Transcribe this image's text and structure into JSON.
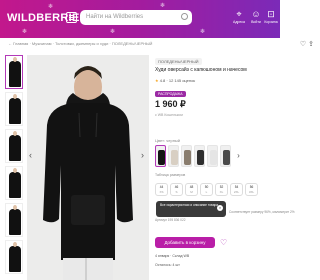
{
  "header": {
    "logo": "WILDBERRIES",
    "search_placeholder": "Найти на Wildberries",
    "icons": [
      {
        "name": "location-icon",
        "label": "Адреса"
      },
      {
        "name": "user-icon",
        "label": "Войти"
      },
      {
        "name": "cart-icon",
        "label": "Корзина"
      }
    ]
  },
  "breadcrumb": "← Главная · Мужчинам · Толстовки, джемперы и худи · ПОЛЕДЕНЬ/ЧЕРНЫЙ",
  "product": {
    "brand": "ПОЛЕДЕНЬ/ЧЕРНЫЙ",
    "title": "Худи оверсайз с капюшоном и начесом",
    "rating": "4.8",
    "reviews": "· 12 145 оценок",
    "badge": "РАСПРОДАЖА",
    "price": "1 960 ₽",
    "price_note": "с WB Кошельком",
    "color_label": "Цвет: черный",
    "size_table_label": "Таблица размеров",
    "sizes": [
      {
        "ru": "44",
        "intl": "XS"
      },
      {
        "ru": "46",
        "intl": "S"
      },
      {
        "ru": "48",
        "intl": "M"
      },
      {
        "ru": "50",
        "intl": "L"
      },
      {
        "ru": "52",
        "intl": "XL"
      },
      {
        "ru": "54",
        "intl": "2XL"
      },
      {
        "ru": "56",
        "intl": "3XL"
      }
    ],
    "tooltip": "Все характеристики и описание товара",
    "fit_note": "Соответствует размеру 96%, маломерит 2%",
    "info": "Артикул 195 836 022",
    "add_to_cart": "Добавить в корзину",
    "delivery": "4 января · Склад WB",
    "stock": "Осталось: 4 шт"
  },
  "colors": {
    "brand_start": "#c2188c",
    "brand_end": "#7b2ab8",
    "accent": "#b91ea7"
  }
}
